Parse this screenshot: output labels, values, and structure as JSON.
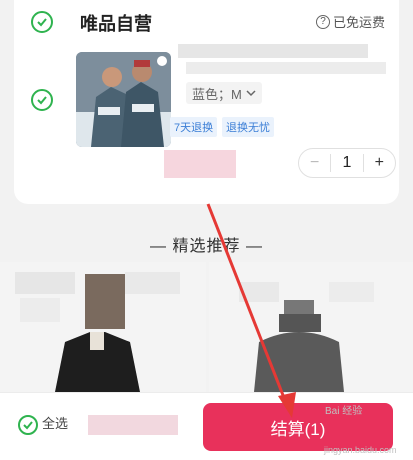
{
  "store": {
    "title": "唯品自营",
    "shipping_label": "已免运费",
    "help_icon": "question-circle-icon"
  },
  "product": {
    "variant": "蓝色；M",
    "tags": [
      "7天退换",
      "退换无忧"
    ],
    "quantity": "1",
    "minus_label": "−",
    "plus_label": "+"
  },
  "recommend": {
    "title": "精选推荐"
  },
  "footer": {
    "select_all": "全选",
    "checkout_label": "结算(1)"
  },
  "watermark": {
    "line1": "Bai 经验",
    "line2": "jingyan.baidu.com"
  },
  "colors": {
    "check_green": "#2fb34f",
    "checkout_red": "#e8315b",
    "tag_blue": "#3c7fd6",
    "annotation_arrow": "#e53935"
  }
}
